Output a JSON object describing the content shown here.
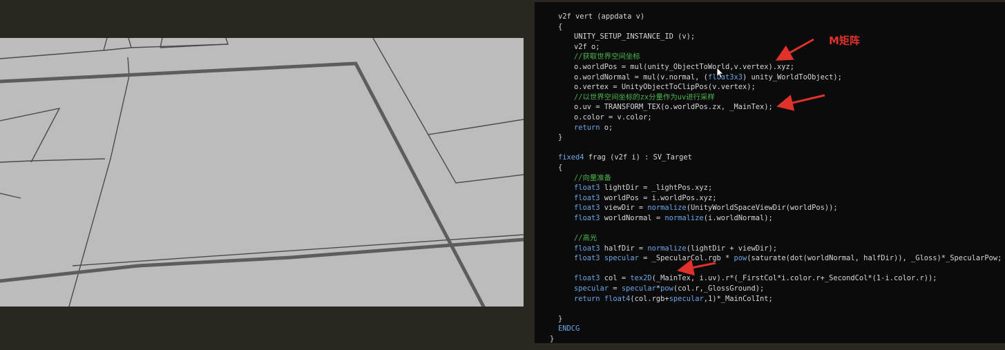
{
  "viewport": {
    "description_label": "",
    "background": "#bdbdbd",
    "groove_color": "#5c5c5c"
  },
  "code": {
    "lines": [
      {
        "indent": 2,
        "segments": [
          {
            "t": "v2f vert (appdata v)",
            "c": "plain"
          }
        ]
      },
      {
        "indent": 2,
        "segments": [
          {
            "t": "{",
            "c": "plain"
          }
        ]
      },
      {
        "indent": 3,
        "segments": [
          {
            "t": "UNITY_SETUP_INSTANCE_ID (v);",
            "c": "plain"
          }
        ]
      },
      {
        "indent": 3,
        "segments": [
          {
            "t": "v2f o;",
            "c": "plain"
          }
        ]
      },
      {
        "indent": 3,
        "segments": [
          {
            "t": "//获取世界空间坐标",
            "c": "cmt"
          }
        ]
      },
      {
        "indent": 3,
        "segments": [
          {
            "t": "o.worldPos = mul(unity_ObjectToWorld,v.vertex).xyz;",
            "c": "plain"
          }
        ]
      },
      {
        "indent": 3,
        "segments": [
          {
            "t": "o.worldNormal = mul(v.normal, (",
            "c": "plain"
          },
          {
            "t": "float3x3",
            "c": "kw"
          },
          {
            "t": ") unity_WorldToObject);",
            "c": "plain"
          }
        ]
      },
      {
        "indent": 3,
        "segments": [
          {
            "t": "o.vertex = UnityObjectToClipPos(v.vertex);",
            "c": "plain"
          }
        ]
      },
      {
        "indent": 3,
        "segments": [
          {
            "t": "//以世界空间坐标的zx分量作为uv进行采样",
            "c": "cmt"
          }
        ]
      },
      {
        "indent": 3,
        "segments": [
          {
            "t": "o.uv = TRANSFORM_TEX(o.worldPos.zx, _MainTex);",
            "c": "plain"
          }
        ]
      },
      {
        "indent": 3,
        "segments": [
          {
            "t": "o.color = v.color;",
            "c": "plain"
          }
        ]
      },
      {
        "indent": 3,
        "segments": [
          {
            "t": "return",
            "c": "kw"
          },
          {
            "t": " o;",
            "c": "plain"
          }
        ]
      },
      {
        "indent": 2,
        "segments": [
          {
            "t": "}",
            "c": "plain"
          }
        ]
      },
      {
        "indent": 0,
        "segments": []
      },
      {
        "indent": 2,
        "segments": [
          {
            "t": "fixed4",
            "c": "kw"
          },
          {
            "t": " frag (v2f i) : SV_Target",
            "c": "plain"
          }
        ]
      },
      {
        "indent": 2,
        "segments": [
          {
            "t": "{",
            "c": "plain"
          }
        ]
      },
      {
        "indent": 3,
        "segments": [
          {
            "t": "//向量准备",
            "c": "cmt"
          }
        ]
      },
      {
        "indent": 3,
        "segments": [
          {
            "t": "float3",
            "c": "kw"
          },
          {
            "t": " lightDir = _lightPos.xyz;",
            "c": "plain"
          }
        ]
      },
      {
        "indent": 3,
        "segments": [
          {
            "t": "float3",
            "c": "kw"
          },
          {
            "t": " worldPos = i.worldPos.xyz;",
            "c": "plain"
          }
        ]
      },
      {
        "indent": 3,
        "segments": [
          {
            "t": "float3",
            "c": "kw"
          },
          {
            "t": " viewDir = ",
            "c": "plain"
          },
          {
            "t": "normalize",
            "c": "kw"
          },
          {
            "t": "(UnityWorldSpaceViewDir(worldPos));",
            "c": "plain"
          }
        ]
      },
      {
        "indent": 3,
        "segments": [
          {
            "t": "float3",
            "c": "kw"
          },
          {
            "t": " worldNormal = ",
            "c": "plain"
          },
          {
            "t": "normalize",
            "c": "kw"
          },
          {
            "t": "(i.worldNormal);",
            "c": "plain"
          }
        ]
      },
      {
        "indent": 0,
        "segments": []
      },
      {
        "indent": 3,
        "segments": [
          {
            "t": "//高光",
            "c": "cmt"
          }
        ]
      },
      {
        "indent": 3,
        "segments": [
          {
            "t": "float3",
            "c": "kw"
          },
          {
            "t": " halfDir = ",
            "c": "plain"
          },
          {
            "t": "normalize",
            "c": "kw"
          },
          {
            "t": "(lightDir + viewDir);",
            "c": "plain"
          }
        ]
      },
      {
        "indent": 3,
        "segments": [
          {
            "t": "float3",
            "c": "kw"
          },
          {
            "t": " ",
            "c": "plain"
          },
          {
            "t": "specular",
            "c": "kw"
          },
          {
            "t": " = _SpecularCol.rgb * ",
            "c": "plain"
          },
          {
            "t": "pow",
            "c": "kw"
          },
          {
            "t": "(saturate(dot(worldNormal, halfDir)), _Gloss)*_SpecularPow;",
            "c": "plain"
          }
        ]
      },
      {
        "indent": 0,
        "segments": []
      },
      {
        "indent": 3,
        "segments": [
          {
            "t": "float3",
            "c": "kw"
          },
          {
            "t": " col = ",
            "c": "plain"
          },
          {
            "t": "tex2D",
            "c": "kw"
          },
          {
            "t": "(_MainTex, i.uv).r*(_FirstCol*i.color.r+_SecondCol*(1-i.color.r));",
            "c": "plain"
          }
        ]
      },
      {
        "indent": 3,
        "segments": [
          {
            "t": "specular",
            "c": "kw"
          },
          {
            "t": " = ",
            "c": "plain"
          },
          {
            "t": "specular",
            "c": "kw"
          },
          {
            "t": "*",
            "c": "plain"
          },
          {
            "t": "pow",
            "c": "kw"
          },
          {
            "t": "(col.r,_GlossGround);",
            "c": "plain"
          }
        ]
      },
      {
        "indent": 3,
        "segments": [
          {
            "t": "return",
            "c": "kw"
          },
          {
            "t": " ",
            "c": "plain"
          },
          {
            "t": "float4",
            "c": "kw"
          },
          {
            "t": "(col.rgb+",
            "c": "plain"
          },
          {
            "t": "specular",
            "c": "kw"
          },
          {
            "t": ",1)*_MainColInt;",
            "c": "plain"
          }
        ]
      },
      {
        "indent": 0,
        "segments": []
      },
      {
        "indent": 2,
        "segments": [
          {
            "t": "}",
            "c": "plain"
          }
        ]
      },
      {
        "indent": 2,
        "segments": [
          {
            "t": "ENDCG",
            "c": "kw"
          }
        ]
      },
      {
        "indent": 1,
        "segments": [
          {
            "t": "}",
            "c": "plain"
          }
        ]
      }
    ]
  },
  "annotation": {
    "label": "M矩阵",
    "color": "#e0312a"
  }
}
